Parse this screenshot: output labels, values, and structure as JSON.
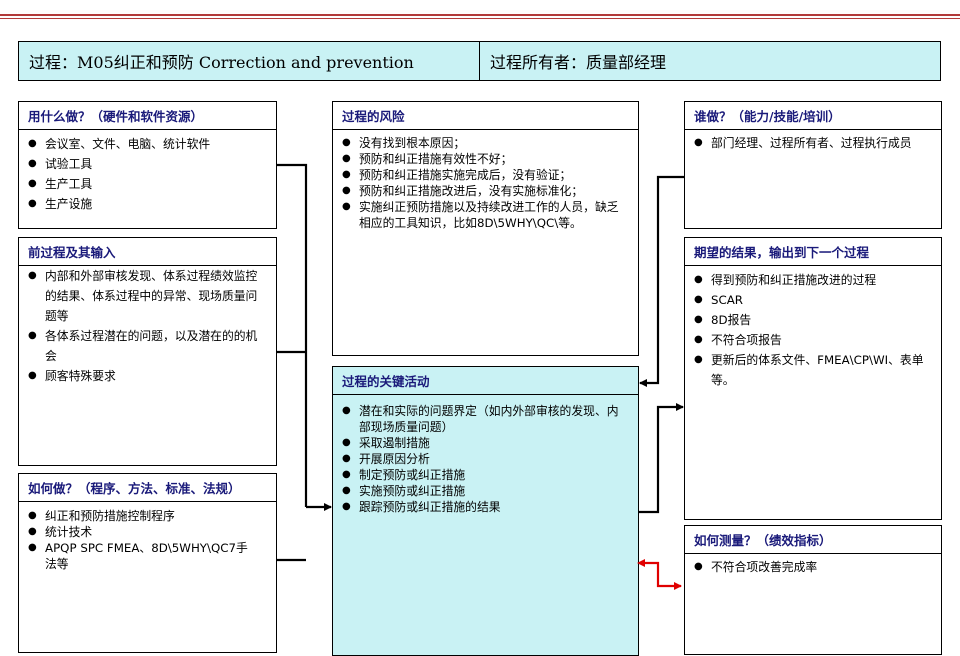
{
  "header": {
    "process": "过程：M05纠正和预防 Correction and prevention",
    "owner": "过程所有者：质量部经理"
  },
  "boxes": {
    "resources": {
      "title": "用什么做？（硬件和软件资源）",
      "items": [
        "会议室、文件、电脑、统计软件",
        "试验工具",
        "生产工具",
        "生产设施"
      ]
    },
    "inputs": {
      "title": "前过程及其输入",
      "items": [
        "内部和外部审核发现、体系过程绩效监控的结果、体系过程中的异常、现场质量问题等",
        "各体系过程潜在的问题，以及潜在的的机会",
        "顾客特殊要求"
      ]
    },
    "methods": {
      "title": "如何做？（程序、方法、标准、法规）",
      "items": [
        "纠正和预防措施控制程序",
        "统计技术",
        "APQP  SPC  FMEA、8D\\5WHY\\QC7手法等"
      ]
    },
    "risks": {
      "title": "过程的风险",
      "items": [
        "没有找到根本原因；",
        "预防和纠正措施有效性不好；",
        "预防和纠正措施实施完成后，没有验证；",
        "预防和纠正措施改进后，没有实施标准化；",
        "实施纠正预防措施以及持续改进工作的人员，缺乏相应的工具知识，比如8D\\5WHY\\QC\\等。"
      ]
    },
    "activities": {
      "title": "过程的关键活动",
      "items": [
        "潜在和实际的问题界定（如内外部审核的发现、内部现场质量问题）",
        "采取遏制措施",
        "开展原因分析",
        "制定预防或纠正措施",
        "实施预防或纠正措施",
        "跟踪预防或纠正措施的结果"
      ]
    },
    "who": {
      "title": "谁做？（能力/技能/培训）",
      "items": [
        "部门经理、过程所有者、过程执行成员"
      ]
    },
    "outputs": {
      "title": "期望的结果，输出到下一个过程",
      "items": [
        "得到预防和纠正措施改进的过程",
        "SCAR",
        "8D报告",
        "不符合项报告",
        "更新后的体系文件、FMEA\\CP\\WI、表单等。"
      ]
    },
    "measure": {
      "title": "如何测量？（绩效指标）",
      "items": [
        "不符合项改善完成率"
      ]
    }
  },
  "colors": {
    "header_bg": "#c9f2f4",
    "title_text": "#1a1a7a",
    "connector": "#000000",
    "feedback_arrow": "#e00000",
    "top_rule": "#b23a3a"
  }
}
